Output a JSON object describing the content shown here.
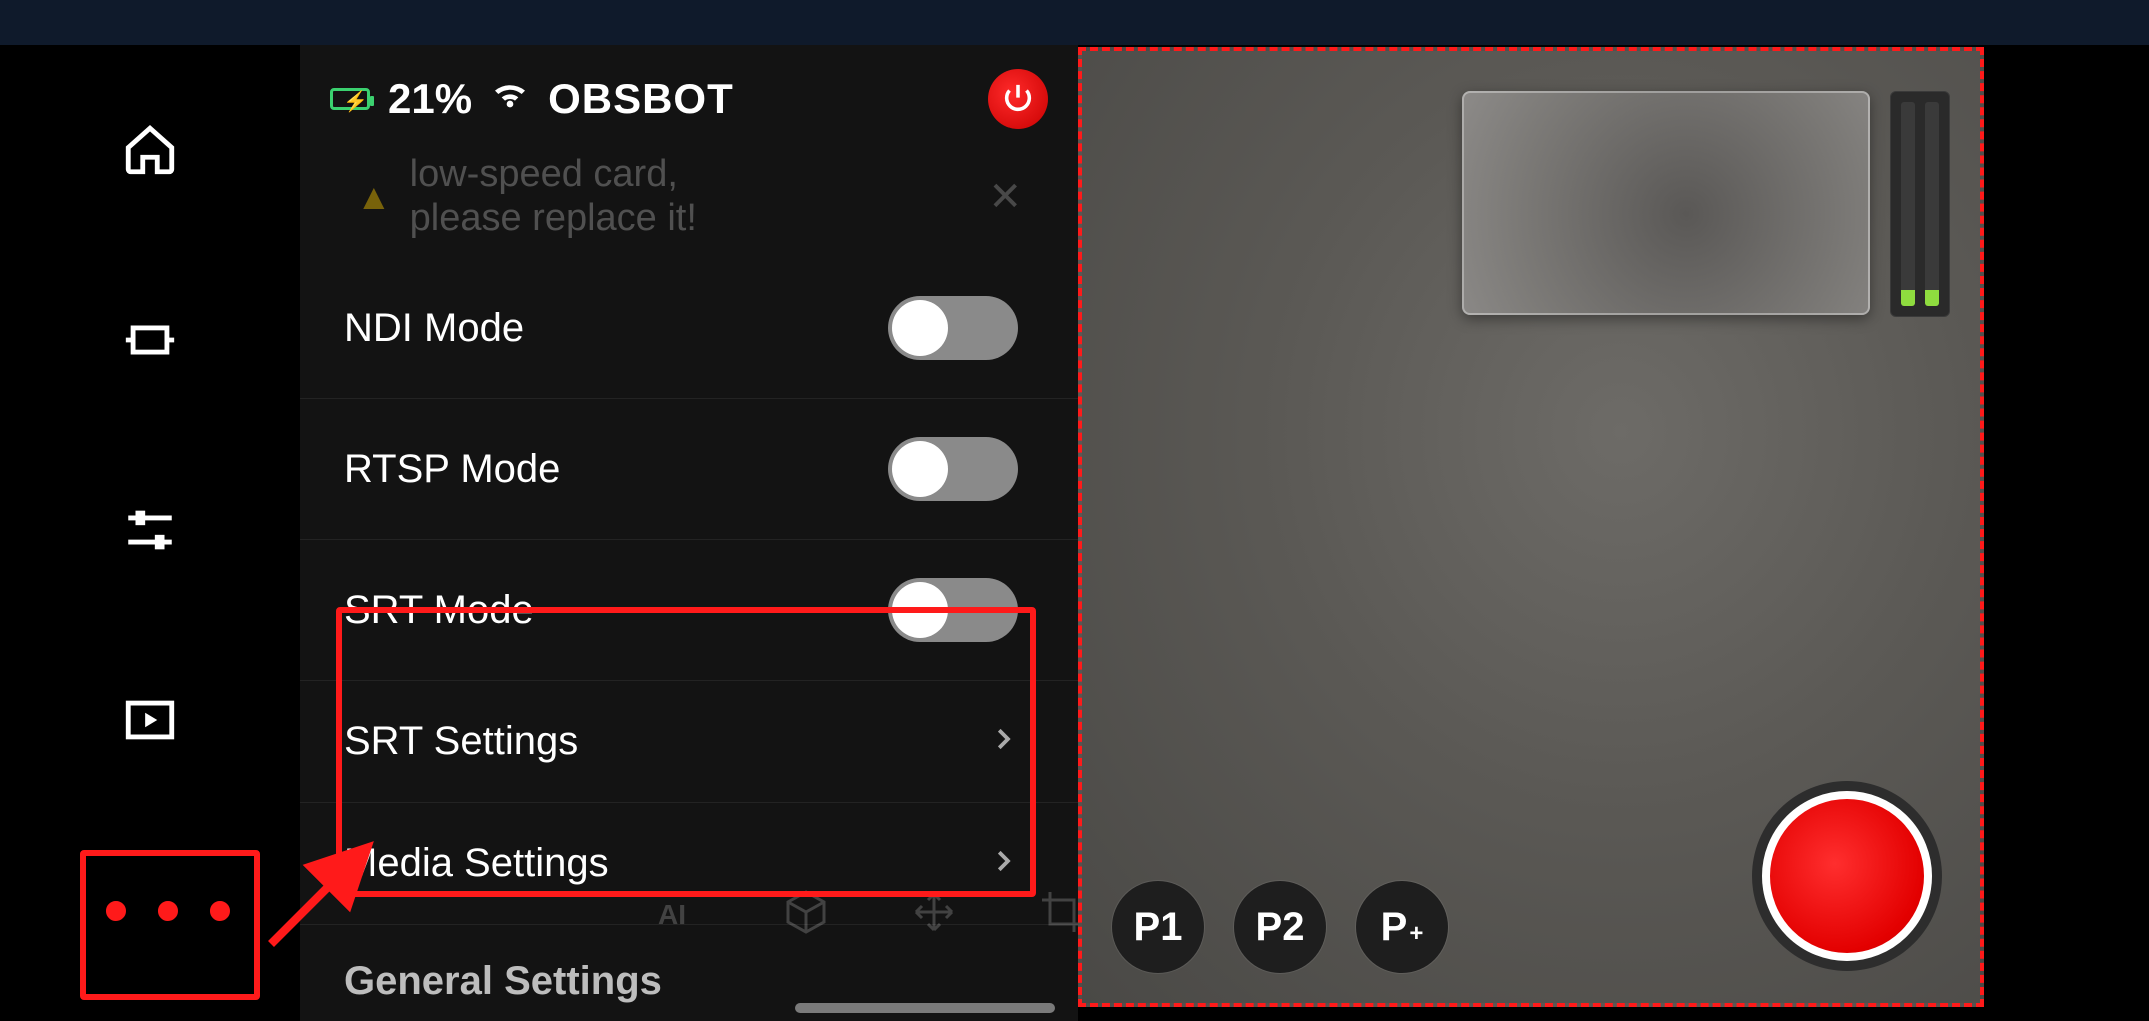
{
  "status": {
    "battery_percent": "21%",
    "device_name": "OBSBOT"
  },
  "alert": {
    "line1": "low-speed card,",
    "line2": "please replace it!"
  },
  "settings": {
    "ndi": {
      "label": "NDI Mode",
      "on": false
    },
    "rtsp": {
      "label": "RTSP Mode",
      "on": false
    },
    "srt": {
      "label": "SRT Mode",
      "on": false
    },
    "srt_settings": {
      "label": "SRT Settings"
    },
    "media_settings": {
      "label": "Media Settings"
    },
    "general_header": "General Settings"
  },
  "presets": {
    "p1": "P1",
    "p2": "P2",
    "padd_prefix": "P",
    "padd_suffix": "+"
  }
}
